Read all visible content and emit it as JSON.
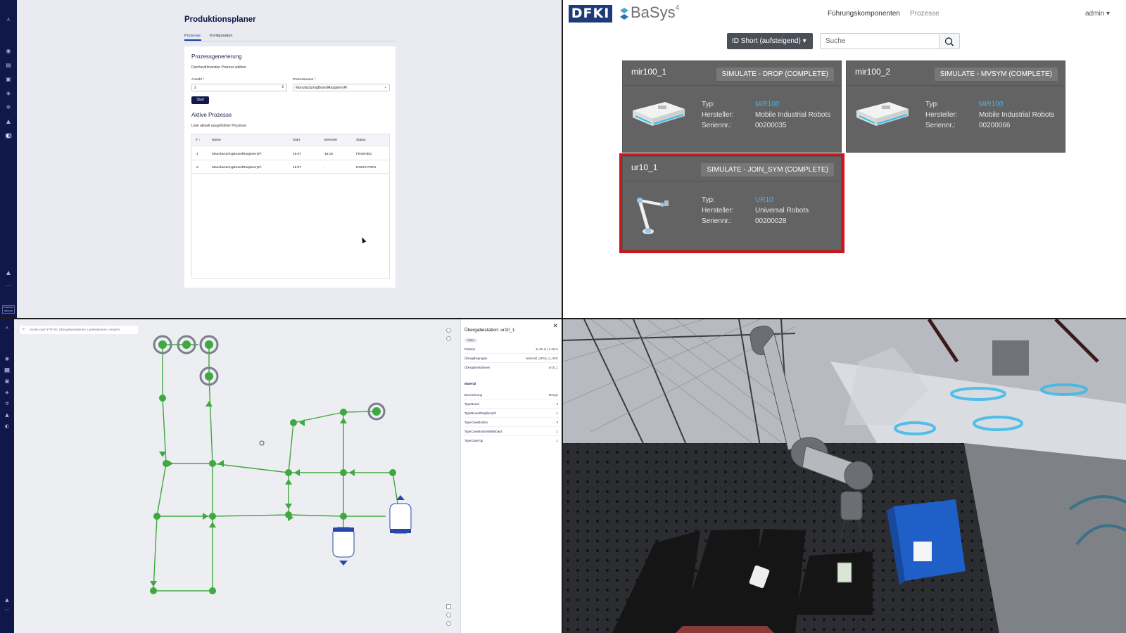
{
  "planner": {
    "title": "Produktionsplaner",
    "tabs": [
      "Prozesse",
      "Konfiguration"
    ],
    "section_generation": "Prozessgenerierung",
    "choose_process": "Durchzuführenden Prozess wählen",
    "count_label": "Anzahl *",
    "count_value": "2",
    "process_label": "Prozessname *",
    "process_value": "ManufacturingBoxedRaspberryPi",
    "start_label": "Start",
    "section_active": "Aktive Prozesse",
    "active_sub": "Liste aktuell ausgeführter Prozesse",
    "columns": [
      "# ↓",
      "Name",
      "Start",
      "Beendet",
      "Status"
    ],
    "rows": [
      {
        "id": "1",
        "name": "ManufacturingBoxedRaspberryPi",
        "start": "16:07",
        "end": "16:16",
        "status": "FINISHED"
      },
      {
        "id": "2",
        "name": "ManufacturingBoxedRaspberryPi",
        "start": "16:07",
        "end": "-",
        "status": "EXECUTION"
      }
    ],
    "sidebar_badge": "INTERNAL INFCON"
  },
  "basyx": {
    "logo_left": "DFKI",
    "logo_right": "BaSys",
    "logo_super": "4",
    "nav": [
      "Führungskomponenten",
      "Prozesse"
    ],
    "user": "admin ▾",
    "sort_label": "ID Short (aufsteigend) ▾",
    "search_placeholder": "Suche",
    "labels": {
      "type": "Typ:",
      "maker": "Hersteller:",
      "serial": "Seriennr.:"
    },
    "assets": [
      {
        "name": "mir100_1",
        "state": "SIMULATE - DROP (COMPLETE)",
        "type": "MiR100",
        "maker": "Mobile Industrial Robots",
        "serial": "00200035"
      },
      {
        "name": "mir100_2",
        "state": "SIMULATE - MVSYM (COMPLETE)",
        "type": "MiR100",
        "maker": "Mobile Industrial Robots",
        "serial": "00200066"
      },
      {
        "name": "ur10_1",
        "state": "SIMULATE - JOIN_SYM (COMPLETE)",
        "type": "UR10",
        "maker": "Universal Robots",
        "serial": "00200028"
      }
    ]
  },
  "map": {
    "search_placeholder": "Suche nach FTF-ID, Übergabestationen, Ladestationen, Ampeln",
    "panel": {
      "title": "Übergabestation: ur10_1",
      "status": "Offline",
      "fields": [
        {
          "k": "Position",
          "v": "11.05 m | 3.48 m"
        },
        {
          "k": "Übergabegruppe",
          "v": "Workcell_UR10_1_HSG"
        },
        {
          "k": "Übergabestationen",
          "v": "ur10_1"
        }
      ],
      "material_title": "Material",
      "material_header": {
        "k": "Bezeichnung",
        "v": "Menge"
      },
      "materials": [
        {
          "k": "TypeBoard",
          "v": "0"
        },
        {
          "k": "TypeBoxedRaspberryPi",
          "v": "1"
        },
        {
          "k": "TypeCaseBottom",
          "v": "0"
        },
        {
          "k": "TypeCaseBottomWithBoard",
          "v": "1"
        },
        {
          "k": "TypeCaseTop",
          "v": "1"
        }
      ]
    }
  }
}
